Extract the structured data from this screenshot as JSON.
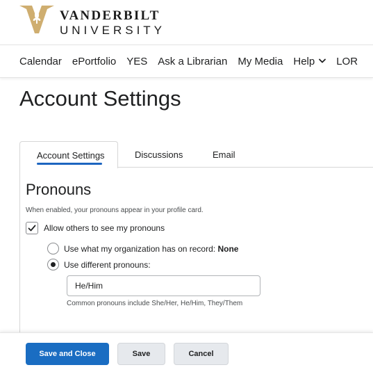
{
  "logo": {
    "line1": "VANDERBILT",
    "line2": "UNIVERSITY",
    "brand_gold": "#cfae70",
    "icon": "vanderbilt-v-oak-leaf-logo"
  },
  "nav": {
    "items": [
      {
        "label": "Calendar"
      },
      {
        "label": "ePortfolio"
      },
      {
        "label": "YES"
      },
      {
        "label": "Ask a Librarian"
      },
      {
        "label": "My Media"
      }
    ],
    "help_label": "Help",
    "help_icon": "chevron-down-icon",
    "lor_label": "LOR"
  },
  "page": {
    "title": "Account Settings"
  },
  "tabs": {
    "active": "Account Settings",
    "items": [
      {
        "label": "Account Settings"
      },
      {
        "label": "Discussions"
      },
      {
        "label": "Email"
      }
    ]
  },
  "pronouns": {
    "title": "Pronouns",
    "help": "When enabled, your pronouns appear in your profile card.",
    "allow_label": "Allow others to see my pronouns",
    "allow_checked": true,
    "option_record_label": "Use what my organization has on record:",
    "option_record_value": "None",
    "option_different_label": "Use different pronouns:",
    "selected_option": "different",
    "input_value": "He/Him",
    "input_help": "Common pronouns include She/Her, He/Him, They/Them"
  },
  "footer": {
    "save_close": "Save and Close",
    "save": "Save",
    "cancel": "Cancel",
    "primary_color": "#1a6dc2"
  }
}
